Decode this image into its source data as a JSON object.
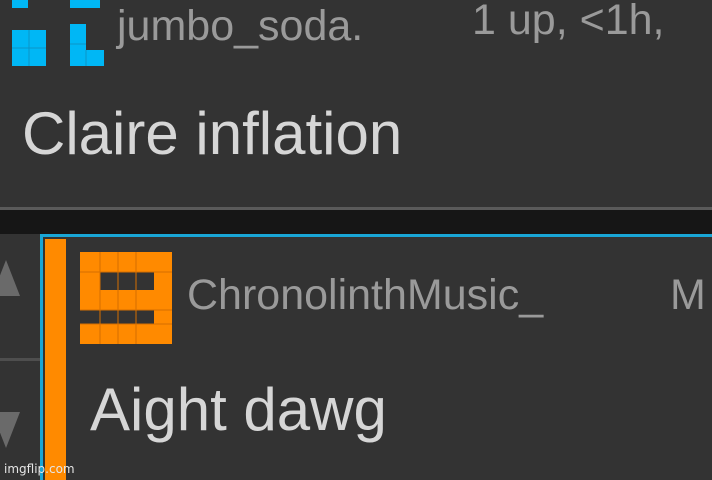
{
  "comments": [
    {
      "username": "jumbo_soda.",
      "meta": "1 up, <1h,",
      "text": "Claire inflation",
      "avatar_color": "#00b7f5"
    },
    {
      "username": "ChronolinthMusic_",
      "meta": "M",
      "text": "Aight dawg",
      "avatar_color": "#ff8a00",
      "highlight_color": "#ff8a00",
      "border_color": "#19a6d6"
    }
  ],
  "vote": {
    "up_icon": "upvote-arrow-icon",
    "down_icon": "downvote-arrow-icon"
  },
  "watermark": "imgflip.com"
}
